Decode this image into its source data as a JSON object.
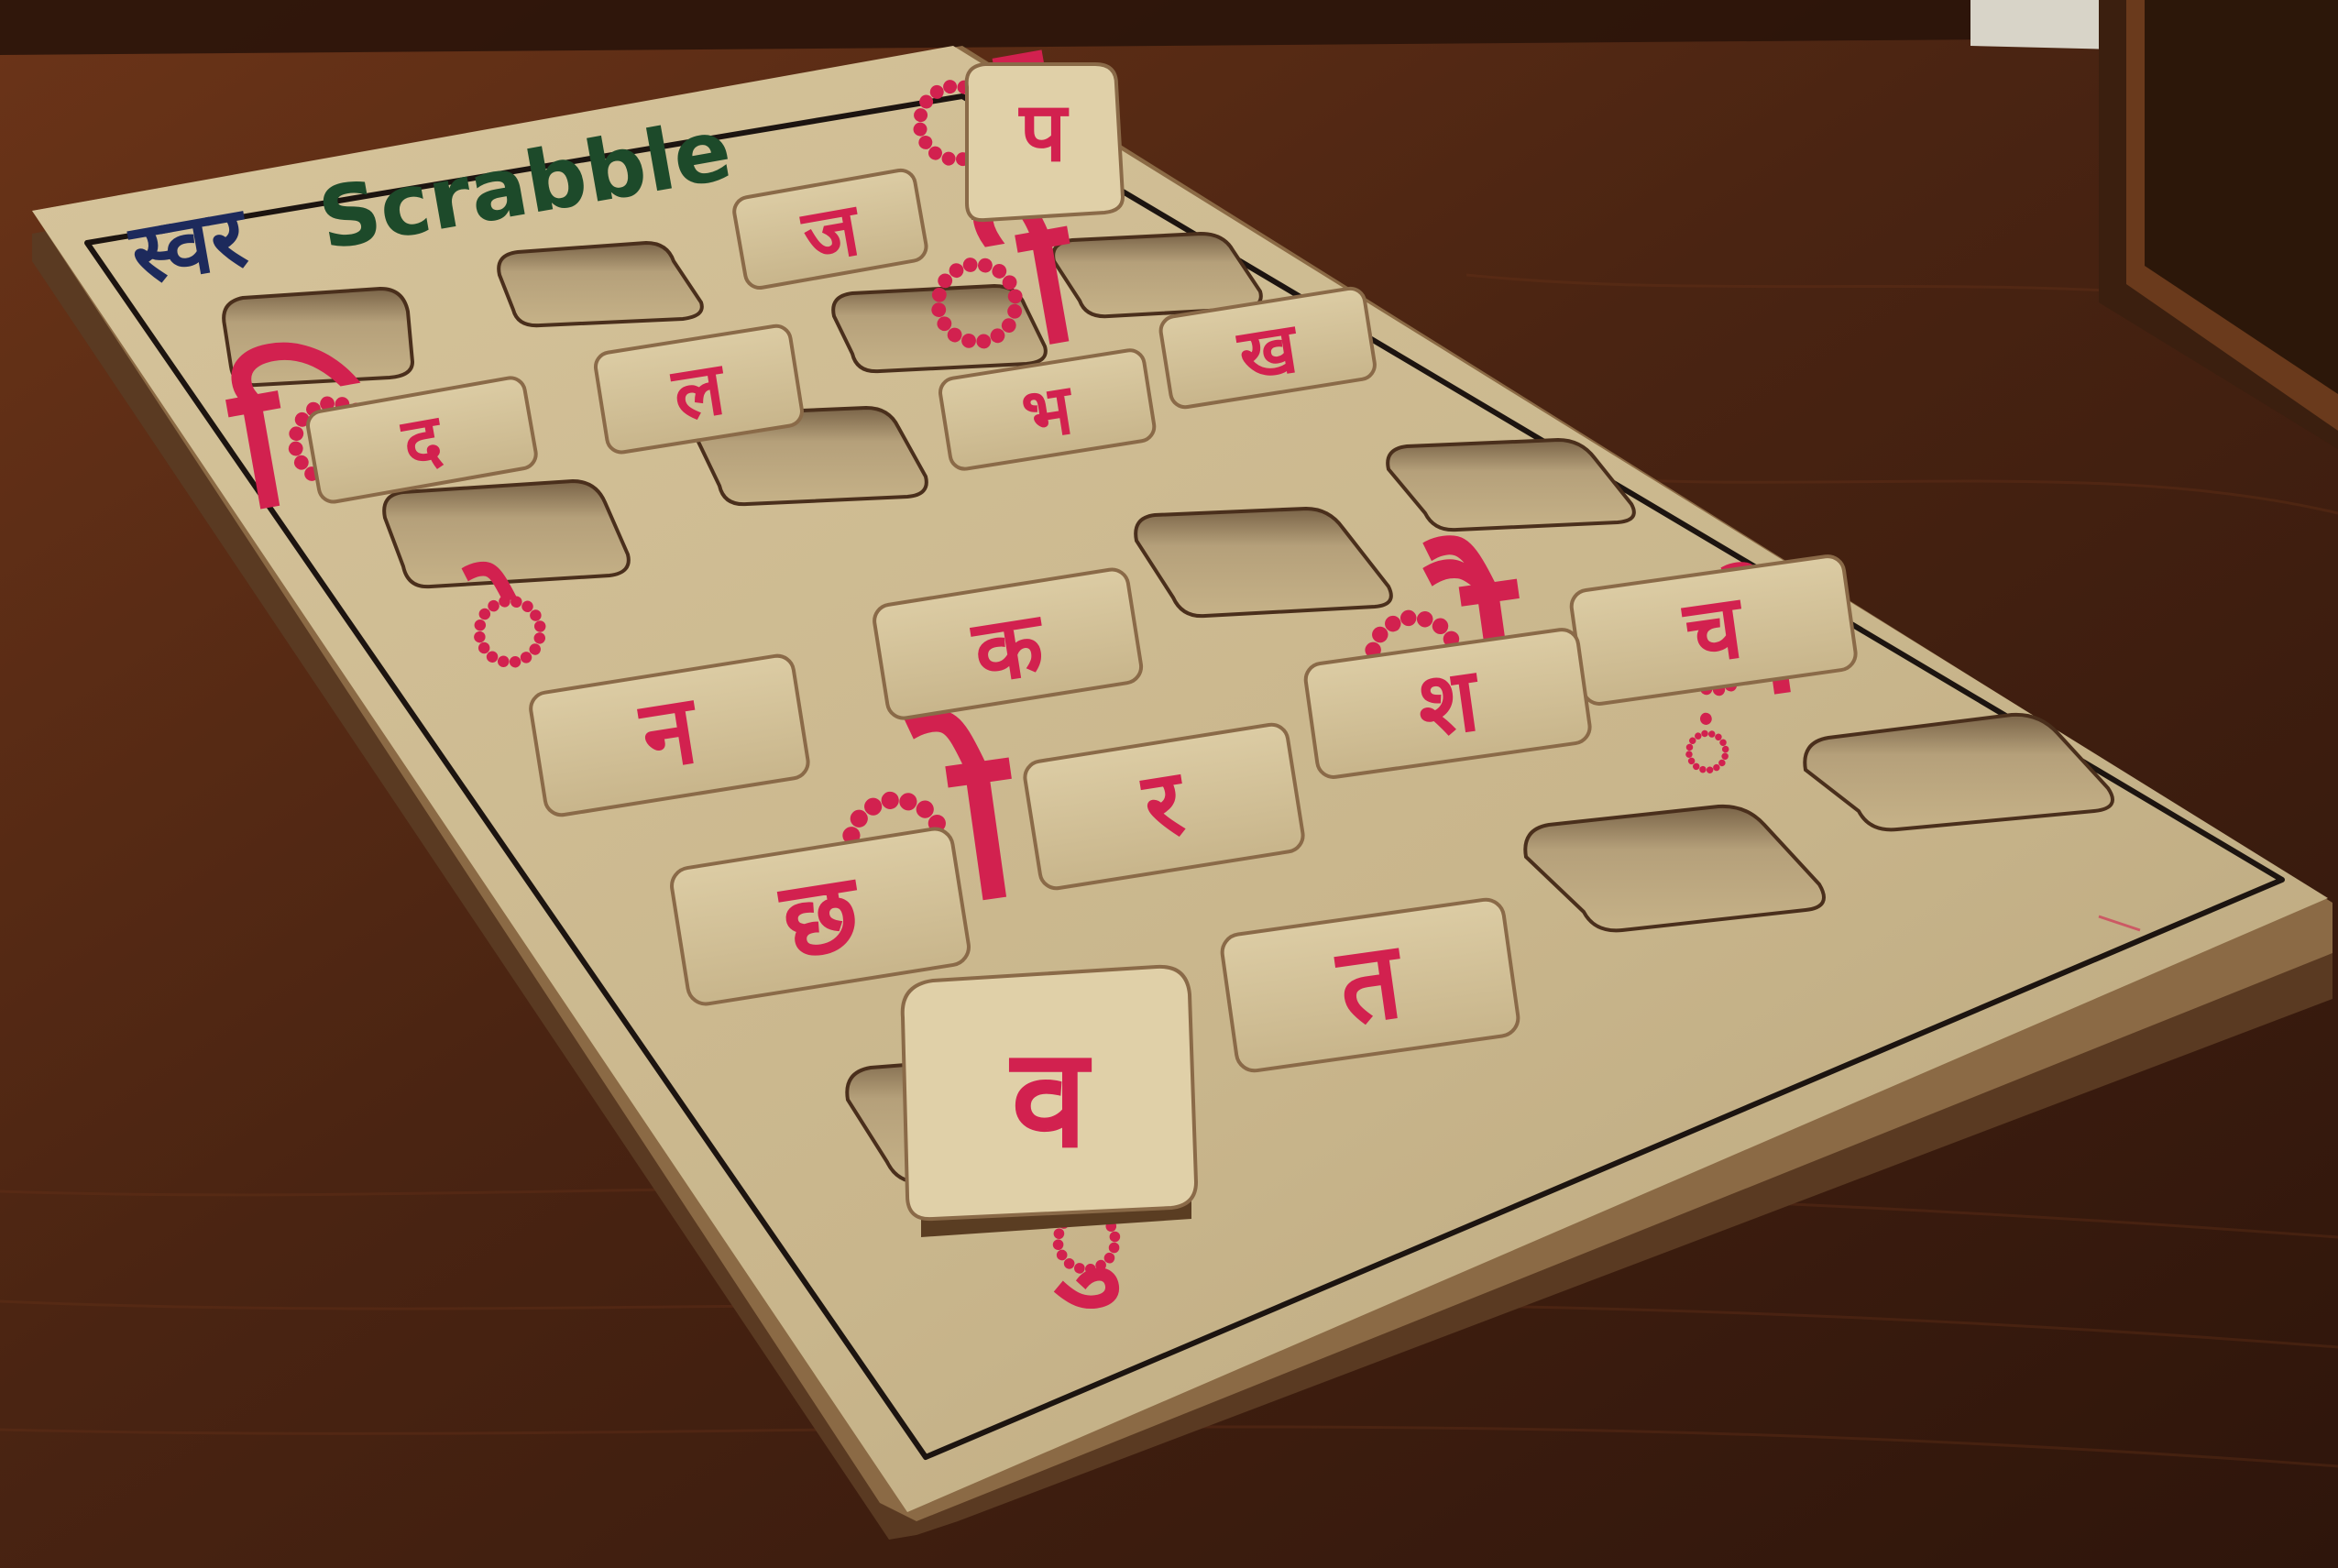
{
  "board": {
    "title_hindi": "स्वर",
    "title_english": "Scrabble",
    "colors": {
      "table": "#4a2412",
      "board": "#cbb88f",
      "ink": "#d2214f",
      "title_blue": "#1d2a5c",
      "title_green": "#1d4a2a"
    }
  },
  "tiles": [
    {
      "id": "tile-ja",
      "letter": "ज",
      "state": "placed"
    },
    {
      "id": "tile-la",
      "letter": "ल",
      "state": "placed"
    },
    {
      "id": "tile-bha",
      "letter": "भ",
      "state": "placed"
    },
    {
      "id": "tile-kha",
      "letter": "ख",
      "state": "placed"
    },
    {
      "id": "tile-da",
      "letter": "द",
      "state": "placed"
    },
    {
      "id": "tile-ka",
      "letter": "क",
      "state": "placed"
    },
    {
      "id": "tile-cha",
      "letter": "च",
      "state": "placed"
    },
    {
      "id": "tile-na",
      "letter": "न",
      "state": "placed"
    },
    {
      "id": "tile-sha",
      "letter": "श",
      "state": "placed"
    },
    {
      "id": "tile-ra",
      "letter": "र",
      "state": "placed"
    },
    {
      "id": "tile-chha",
      "letter": "छ",
      "state": "placed"
    },
    {
      "id": "tile-ta",
      "letter": "त",
      "state": "placed"
    },
    {
      "id": "tile-pa",
      "letter": "प",
      "state": "standing"
    },
    {
      "id": "tile-va",
      "letter": "व",
      "state": "standing"
    }
  ],
  "matra_marks": [
    {
      "id": "mark-ii",
      "glyph": "ी"
    },
    {
      "id": "mark-i",
      "glyph": "ि"
    },
    {
      "id": "mark-au-1",
      "glyph": "ौ"
    },
    {
      "id": "mark-au-2",
      "glyph": "ौ"
    },
    {
      "id": "mark-o",
      "glyph": "ो"
    },
    {
      "id": "mark-aa",
      "glyph": "ा"
    },
    {
      "id": "mark-u",
      "glyph": "ु"
    },
    {
      "id": "mark-e",
      "glyph": "े"
    },
    {
      "id": "mark-anusvara",
      "glyph": "ं"
    }
  ]
}
